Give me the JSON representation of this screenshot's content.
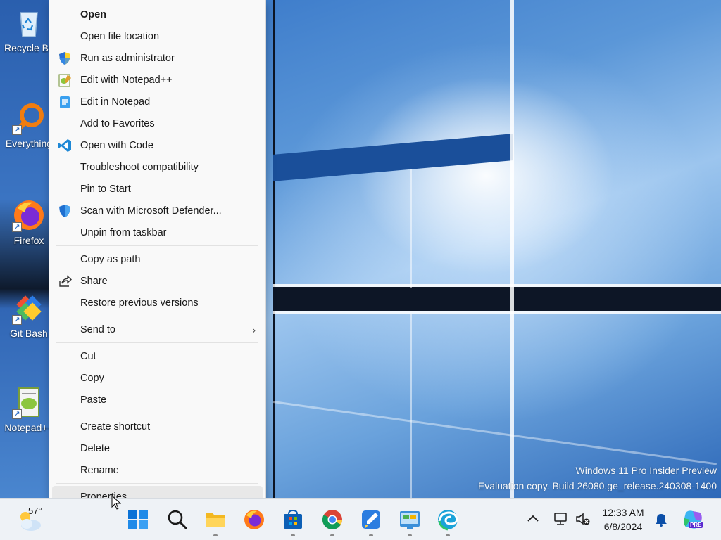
{
  "desktop_icons": [
    {
      "label": "Recycle Bin",
      "icon": "recycle-bin-icon"
    },
    {
      "label": "Everything",
      "icon": "everything-search-icon"
    },
    {
      "label": "Firefox",
      "icon": "firefox-icon"
    },
    {
      "label": "Git Bash",
      "icon": "git-bash-icon"
    },
    {
      "label": "Notepad++",
      "icon": "notepadpp-icon"
    }
  ],
  "context_menu": {
    "groups": [
      [
        {
          "label": "Open",
          "icon": "",
          "bold": true
        },
        {
          "label": "Open file location",
          "icon": ""
        },
        {
          "label": "Run as administrator",
          "icon": "uac-shield-icon"
        },
        {
          "label": "Edit with Notepad++",
          "icon": "notepadpp-icon"
        },
        {
          "label": "Edit in Notepad",
          "icon": "notepad-icon"
        },
        {
          "label": "Add to Favorites",
          "icon": ""
        },
        {
          "label": "Open with Code",
          "icon": "vscode-icon"
        },
        {
          "label": "Troubleshoot compatibility",
          "icon": ""
        },
        {
          "label": "Pin to Start",
          "icon": ""
        },
        {
          "label": "Scan with Microsoft Defender...",
          "icon": "defender-shield-icon"
        },
        {
          "label": "Unpin from taskbar",
          "icon": ""
        }
      ],
      [
        {
          "label": "Copy as path",
          "icon": ""
        },
        {
          "label": "Share",
          "icon": "share-icon"
        },
        {
          "label": "Restore previous versions",
          "icon": ""
        }
      ],
      [
        {
          "label": "Send to",
          "icon": "",
          "submenu": true
        }
      ],
      [
        {
          "label": "Cut",
          "icon": ""
        },
        {
          "label": "Copy",
          "icon": ""
        },
        {
          "label": "Paste",
          "icon": ""
        }
      ],
      [
        {
          "label": "Create shortcut",
          "icon": ""
        },
        {
          "label": "Delete",
          "icon": ""
        },
        {
          "label": "Rename",
          "icon": ""
        }
      ],
      [
        {
          "label": "Properties",
          "icon": "",
          "hover": true
        }
      ]
    ]
  },
  "watermark": {
    "line1": "Windows 11 Pro Insider Preview",
    "line2": "Evaluation copy. Build 26080.ge_release.240308-1400"
  },
  "taskbar": {
    "weather": {
      "temperature": "57°",
      "icon": "partly-cloudy-icon"
    },
    "apps": [
      {
        "name": "start-button",
        "icon": "windows-logo-icon",
        "running": false
      },
      {
        "name": "search-button",
        "icon": "search-icon",
        "running": false
      },
      {
        "name": "file-explorer",
        "icon": "folder-icon",
        "running": true
      },
      {
        "name": "firefox",
        "icon": "firefox-icon",
        "running": false
      },
      {
        "name": "microsoft-store",
        "icon": "store-icon",
        "running": true
      },
      {
        "name": "chrome",
        "icon": "chrome-icon",
        "running": true
      },
      {
        "name": "paint",
        "icon": "paint-icon",
        "running": true
      },
      {
        "name": "control-panel",
        "icon": "control-panel-icon",
        "running": true
      },
      {
        "name": "edge",
        "icon": "edge-icon",
        "running": true
      }
    ],
    "tray": {
      "chevron_icon": "chevron-up-icon",
      "network_icon": "network-icon",
      "volume_icon": "volume-muted-icon"
    },
    "clock": {
      "time": "12:33 AM",
      "date": "6/8/2024"
    },
    "notification_icon": "bell-icon",
    "copilot_badge": "PRE"
  },
  "colors": {
    "menu_bg": "#f9f9f9",
    "menu_hover": "#e8e8e8",
    "taskbar_bg": "#eef2f6",
    "accent": "#0067c0"
  }
}
